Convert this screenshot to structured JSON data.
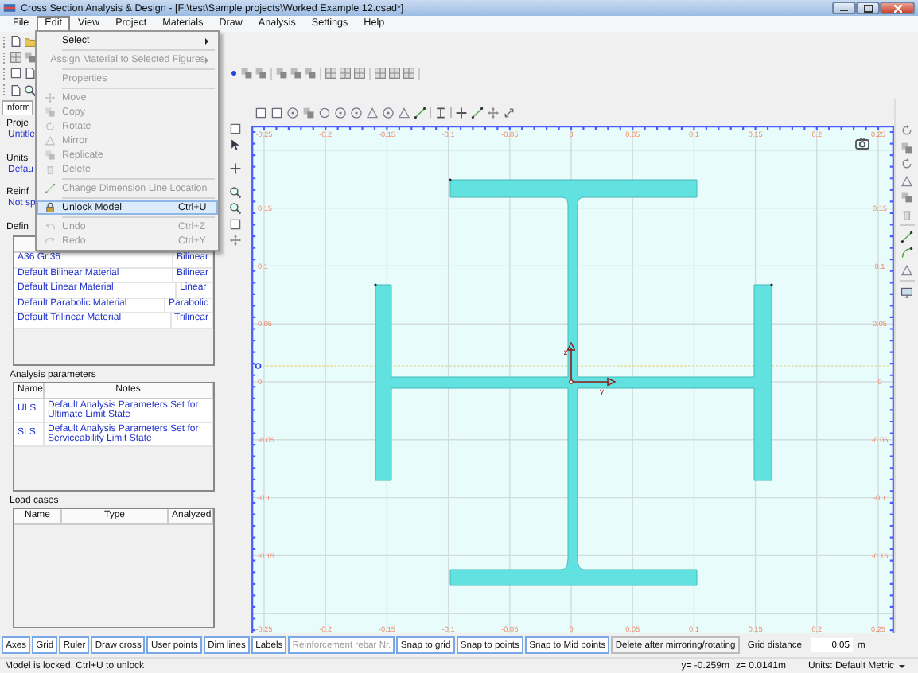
{
  "window": {
    "title": "Cross Section Analysis & Design - [F:\\test\\Sample projects\\Worked Example 12.csad*]"
  },
  "menu_bar": [
    {
      "label": "File",
      "selected": false
    },
    {
      "label": "Edit",
      "selected": true
    },
    {
      "label": "View",
      "selected": false
    },
    {
      "label": "Project",
      "selected": false
    },
    {
      "label": "Materials",
      "selected": false
    },
    {
      "label": "Draw",
      "selected": false
    },
    {
      "label": "Analysis",
      "selected": false
    },
    {
      "label": "Settings",
      "selected": false
    },
    {
      "label": "Help",
      "selected": false
    }
  ],
  "edit_menu": [
    {
      "kind": "item",
      "label": "Select",
      "submenu": true,
      "disabled": false,
      "highlighted": false
    },
    {
      "kind": "separator"
    },
    {
      "kind": "item",
      "label": "Assign Material to Selected Figures",
      "submenu": true,
      "disabled": true,
      "highlighted": false
    },
    {
      "kind": "separator"
    },
    {
      "kind": "item",
      "label": "Properties",
      "submenu": false,
      "disabled": true,
      "highlighted": false
    },
    {
      "kind": "separator"
    },
    {
      "kind": "item",
      "label": "Move",
      "submenu": false,
      "disabled": true,
      "highlighted": false
    },
    {
      "kind": "item",
      "label": "Copy",
      "submenu": false,
      "disabled": true,
      "highlighted": false
    },
    {
      "kind": "item",
      "label": "Rotate",
      "submenu": false,
      "disabled": true,
      "highlighted": false
    },
    {
      "kind": "item",
      "label": "Mirror",
      "submenu": false,
      "disabled": true,
      "highlighted": false
    },
    {
      "kind": "item",
      "label": "Replicate",
      "submenu": false,
      "disabled": true,
      "highlighted": false
    },
    {
      "kind": "item",
      "label": "Delete",
      "submenu": false,
      "disabled": true,
      "highlighted": false
    },
    {
      "kind": "separator"
    },
    {
      "kind": "item",
      "label": "Change Dimension Line Location",
      "submenu": false,
      "disabled": true,
      "highlighted": false
    },
    {
      "kind": "separator"
    },
    {
      "kind": "item",
      "label": "Unlock Model",
      "shortcut": "Ctrl+U",
      "submenu": false,
      "disabled": false,
      "highlighted": true
    },
    {
      "kind": "separator"
    },
    {
      "kind": "item",
      "label": "Undo",
      "shortcut": "Ctrl+Z",
      "submenu": false,
      "disabled": true,
      "highlighted": false
    },
    {
      "kind": "item",
      "label": "Redo",
      "shortcut": "Ctrl+Y",
      "submenu": false,
      "disabled": true,
      "highlighted": false
    }
  ],
  "left_panel": {
    "tabs": [
      {
        "label": "Inform",
        "selected": true
      }
    ],
    "groups": [
      {
        "title": "Proje",
        "value": "Untitle"
      },
      {
        "title": "Units",
        "value": "Defau"
      },
      {
        "title": "Reinf",
        "value": "Not sp"
      },
      {
        "title": "Defin"
      }
    ],
    "materials": [
      {
        "name": "A36 Gr.36",
        "type": "Bilinear"
      },
      {
        "name": "Default Bilinear Material",
        "type": "Bilinear"
      },
      {
        "name": "Default Linear Material",
        "type": "Linear"
      },
      {
        "name": "Default Parabolic Material",
        "type": "Parabolic"
      },
      {
        "name": "Default Trilinear Material",
        "type": "Trilinear"
      }
    ],
    "analysis_parameters": {
      "title": "Analysis parameters",
      "columns": [
        "Name",
        "Notes"
      ],
      "rows": [
        {
          "name": "ULS",
          "notes": "Default Analysis Parameters Set for Ultimate Limit State"
        },
        {
          "name": "SLS",
          "notes": "Default Analysis Parameters Set for Serviceability Limit State"
        }
      ]
    },
    "load_cases": {
      "title": "Load cases",
      "columns": [
        "Name",
        "Type",
        "Analyzed"
      ]
    }
  },
  "canvas": {
    "top_ticks": [
      "-0.25",
      "-0.2",
      "-0.15",
      "-0.1",
      "-0.05",
      "0",
      "0.05",
      "0.1",
      "0.15",
      "0.2",
      "0.25"
    ],
    "bottom_ticks": [
      "-0.25",
      "-0.2",
      "-0.15",
      "-0.1",
      "-0.05",
      "0",
      "0.05",
      "0.1",
      "0.15",
      "0.2",
      "0.25"
    ],
    "left_ticks": [
      "0.15",
      "0.1",
      "0.05",
      "0",
      "-0.05",
      "-0.1",
      "-0.15"
    ],
    "right_ticks": [
      "0.15",
      "0.1",
      "0.05",
      "0",
      "-0.05",
      "-0.1",
      "-0.15"
    ],
    "z_label": "z",
    "y_label": "y"
  },
  "bottom_bar": {
    "buttons": [
      {
        "label": "Axes",
        "on": true,
        "disabled": false
      },
      {
        "label": "Grid",
        "on": true,
        "disabled": false
      },
      {
        "label": "Ruler",
        "on": true,
        "disabled": false
      },
      {
        "label": "Draw cross",
        "on": true,
        "disabled": false
      },
      {
        "label": "User points",
        "on": true,
        "disabled": false
      },
      {
        "label": "Dim lines",
        "on": true,
        "disabled": false
      },
      {
        "label": "Labels",
        "on": true,
        "disabled": false
      },
      {
        "label": "Reinforcement rebar Nr.",
        "on": true,
        "disabled": true
      },
      {
        "label": "Snap to grid",
        "on": true,
        "disabled": false
      },
      {
        "label": "Snap to points",
        "on": true,
        "disabled": false
      },
      {
        "label": "Snap to Mid points",
        "on": true,
        "disabled": false
      },
      {
        "label": "Delete after mirroring/rotating",
        "on": false,
        "disabled": false
      }
    ],
    "grid_distance": {
      "label": "Grid distance",
      "value": "0.05",
      "unit": "m"
    }
  },
  "status_bar": {
    "message": "Model is locked. Ctrl+U to unlock",
    "y": "y= -0.259m",
    "z": "z= 0.0141m",
    "units": "Units: Default Metric"
  }
}
